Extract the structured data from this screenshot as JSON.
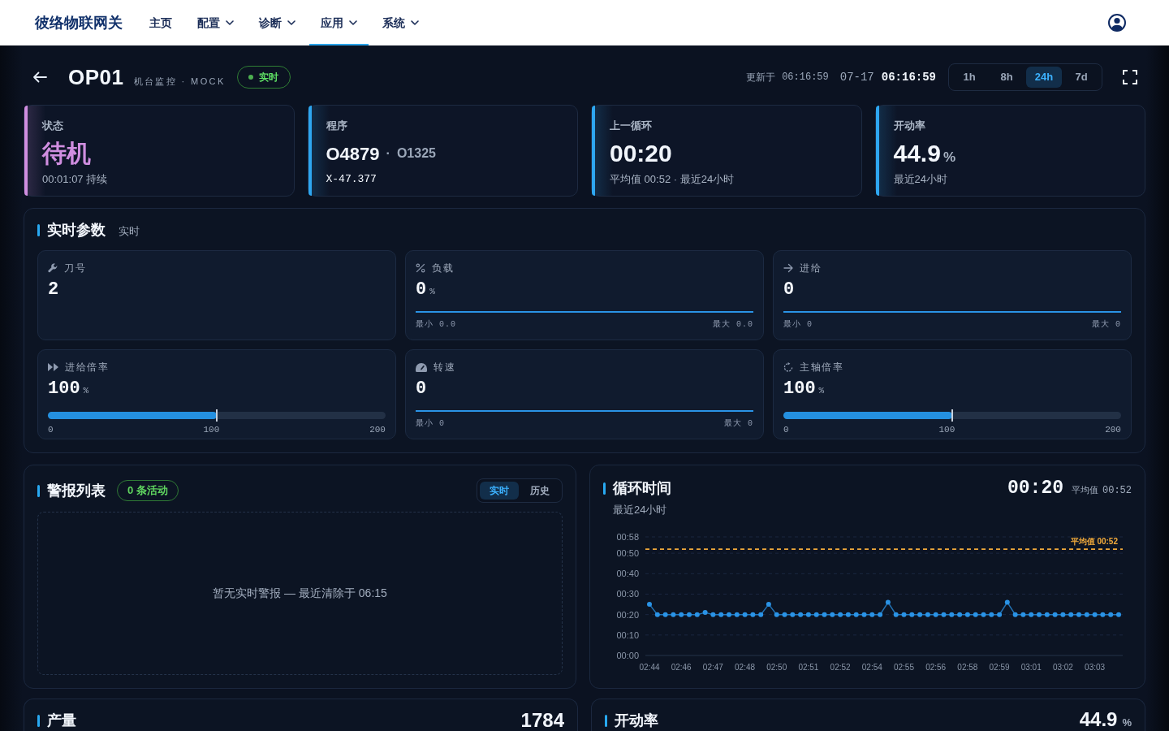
{
  "navbar": {
    "brand": "彼络物联网关",
    "items": [
      {
        "label": "主页",
        "dropdown": false,
        "selected": false
      },
      {
        "label": "配置",
        "dropdown": true,
        "selected": false
      },
      {
        "label": "诊断",
        "dropdown": true,
        "selected": false
      },
      {
        "label": "应用",
        "dropdown": true,
        "selected": true
      },
      {
        "label": "系统",
        "dropdown": true,
        "selected": false
      }
    ]
  },
  "header": {
    "title": "OP01",
    "subtitle": "机台监控 · MOCK",
    "live_badge": "实时",
    "updated_label": "更新于",
    "updated_time": "06:16:59",
    "date": "07-17",
    "clock": "06:16:59",
    "ranges": [
      {
        "label": "1h",
        "selected": false
      },
      {
        "label": "8h",
        "selected": false
      },
      {
        "label": "24h",
        "selected": true
      },
      {
        "label": "7d",
        "selected": false
      }
    ]
  },
  "kpis": [
    {
      "kind": "status",
      "label": "状态",
      "value": "待机",
      "note": "00:01:07 持续",
      "color": "#d08ee0"
    },
    {
      "kind": "program",
      "label": "程序",
      "value": "O4879",
      "separator": "·",
      "secondary": "O1325",
      "detail": "X-47.377",
      "color": "#2ea6f0"
    },
    {
      "kind": "metric",
      "label": "上一循环",
      "value": "00:20",
      "note": "平均值 00:52 · 最近24小时",
      "color": "#2ea6f0"
    },
    {
      "kind": "metric",
      "label": "开动率",
      "value": "44.9",
      "unit": "%",
      "note": "最近24小时",
      "color": "#2ea6f0"
    }
  ],
  "realtime_params": {
    "title": "实时参数",
    "tag": "实时",
    "tiles": [
      {
        "kind": "plain",
        "label": "刀号",
        "value": "2"
      },
      {
        "kind": "trend",
        "label": "负载",
        "value": "0",
        "unit": "%",
        "min": "最小 0.0",
        "max": "最大 0.0"
      },
      {
        "kind": "trend",
        "label": "进给",
        "value": "0",
        "min": "最小 0",
        "max": "最大 0"
      },
      {
        "kind": "gauge",
        "label": "进给倍率",
        "value": "100",
        "unit": "%",
        "level": 0.5,
        "ticks": [
          "0",
          "100",
          "200"
        ]
      },
      {
        "kind": "trend",
        "label": "转速",
        "value": "0",
        "min": "最小 0",
        "max": "最大 0"
      },
      {
        "kind": "gauge",
        "label": "主轴倍率",
        "value": "100",
        "unit": "%",
        "level": 0.5,
        "ticks": [
          "0",
          "100",
          "200"
        ]
      }
    ]
  },
  "alarms": {
    "title": "警报列表",
    "badge": "0 条活动",
    "views": [
      {
        "label": "实时",
        "selected": true
      },
      {
        "label": "历史",
        "selected": false
      }
    ],
    "empty_text": "暂无实时警报 — 最近清除于 06:15"
  },
  "cycle_time": {
    "title": "循环时间",
    "subtitle": "最近24小时",
    "current": "00:20",
    "avg_label": "平均值",
    "avg_value": "00:52",
    "chart_data": {
      "type": "line",
      "categories": [
        "02:44",
        null,
        null,
        null,
        "02:46",
        null,
        null,
        null,
        "02:47",
        null,
        null,
        null,
        "02:48",
        null,
        null,
        null,
        "02:50",
        null,
        null,
        null,
        "02:51",
        null,
        null,
        null,
        "02:52",
        null,
        null,
        null,
        "02:54",
        null,
        null,
        null,
        "02:55",
        null,
        null,
        null,
        "02:56",
        null,
        null,
        null,
        "02:58",
        null,
        null,
        null,
        "02:59",
        null,
        null,
        null,
        "03:01",
        null,
        null,
        null,
        "03:02",
        null,
        null,
        null,
        "03:03",
        null,
        null,
        null
      ],
      "ylim": [
        0,
        58
      ],
      "yticks": [
        {
          "value": 0,
          "label": "00:00"
        },
        {
          "value": 10,
          "label": "00:10"
        },
        {
          "value": 20,
          "label": "00:20"
        },
        {
          "value": 30,
          "label": "00:30"
        },
        {
          "value": 40,
          "label": "00:40"
        },
        {
          "value": 50,
          "label": "00:50"
        },
        {
          "value": 58,
          "label": "00:58"
        }
      ],
      "grid": true,
      "series": [
        {
          "color": "#2a93e6",
          "marker": "circle",
          "values": [
            25,
            20,
            20,
            20,
            20,
            20,
            20,
            21,
            20,
            20,
            20,
            20,
            20,
            20,
            20,
            25,
            20,
            20,
            20,
            20,
            20,
            20,
            20,
            20,
            20,
            20,
            20,
            20,
            20,
            20,
            26,
            20,
            20,
            20,
            20,
            20,
            20,
            20,
            20,
            20,
            20,
            20,
            20,
            20,
            20,
            26,
            20,
            20,
            20,
            20,
            20,
            20,
            20,
            20,
            20,
            20,
            20,
            20,
            20,
            20
          ]
        }
      ],
      "ref_lines": [
        {
          "axis": "y",
          "value": 52,
          "label": "平均值 00:52",
          "color": "#f0a93b"
        }
      ]
    }
  },
  "summary_panels": [
    {
      "title": "产量",
      "value": "1784"
    },
    {
      "title": "开动率",
      "value": "44.9",
      "unit": "%"
    }
  ]
}
